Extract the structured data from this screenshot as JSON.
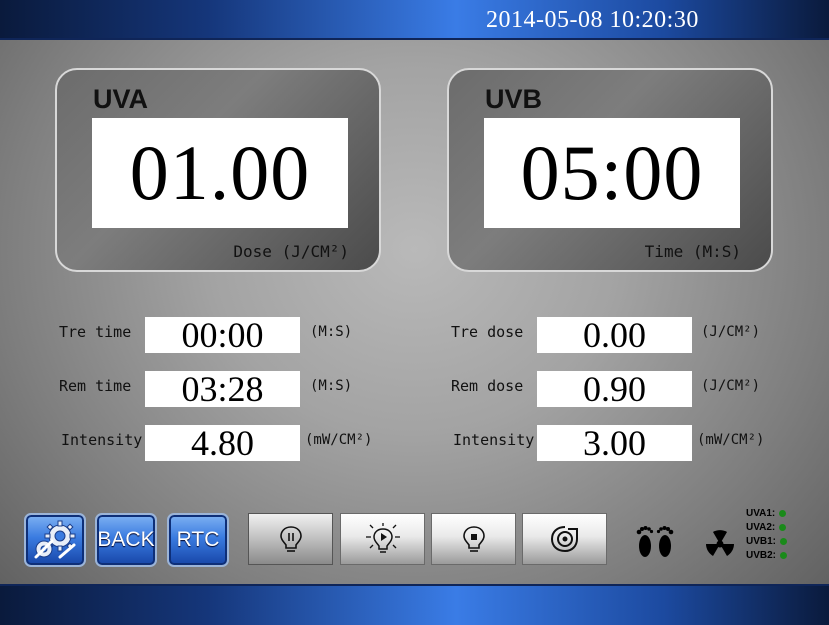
{
  "header": {
    "datetime": "2014-05-08 10:20:30"
  },
  "uva_panel": {
    "title": "UVA",
    "value": "01.00",
    "unit": "Dose (J/CM²)"
  },
  "uvb_panel": {
    "title": "UVB",
    "value": "05:00",
    "unit": "Time (M:S)"
  },
  "uva_rows": [
    {
      "label": "Tre time",
      "value": "00:00",
      "unit": "(M:S)"
    },
    {
      "label": "Rem time",
      "value": "03:28",
      "unit": "(M:S)"
    },
    {
      "label": "Intensity",
      "value": "4.80",
      "unit": "(mW/CM²)"
    }
  ],
  "uvb_rows": [
    {
      "label": "Tre dose",
      "value": "0.00",
      "unit": "(J/CM²)"
    },
    {
      "label": "Rem dose",
      "value": "0.90",
      "unit": "(J/CM²)"
    },
    {
      "label": "Intensity",
      "value": "3.00",
      "unit": "(mW/CM²)"
    }
  ],
  "toolbar": {
    "settings_icon": "gears-icon",
    "back_label": "BACK",
    "rtc_label": "RTC",
    "mode_buttons": [
      "bulb-pause-icon",
      "bulb-play-icon",
      "bulb-stop-icon",
      "fan-icon"
    ],
    "active_mode": "bulb-pause-icon"
  },
  "indicators": {
    "feet_icon": "feet-icon",
    "radiation_icon": "radiation-icon",
    "lamps": [
      {
        "label": "UVA1:",
        "color": "#1a8a1a"
      },
      {
        "label": "UVA2:",
        "color": "#1a8a1a"
      },
      {
        "label": "UVB1:",
        "color": "#1a8a1a"
      },
      {
        "label": "UVB2:",
        "color": "#1a8a1a"
      }
    ]
  }
}
